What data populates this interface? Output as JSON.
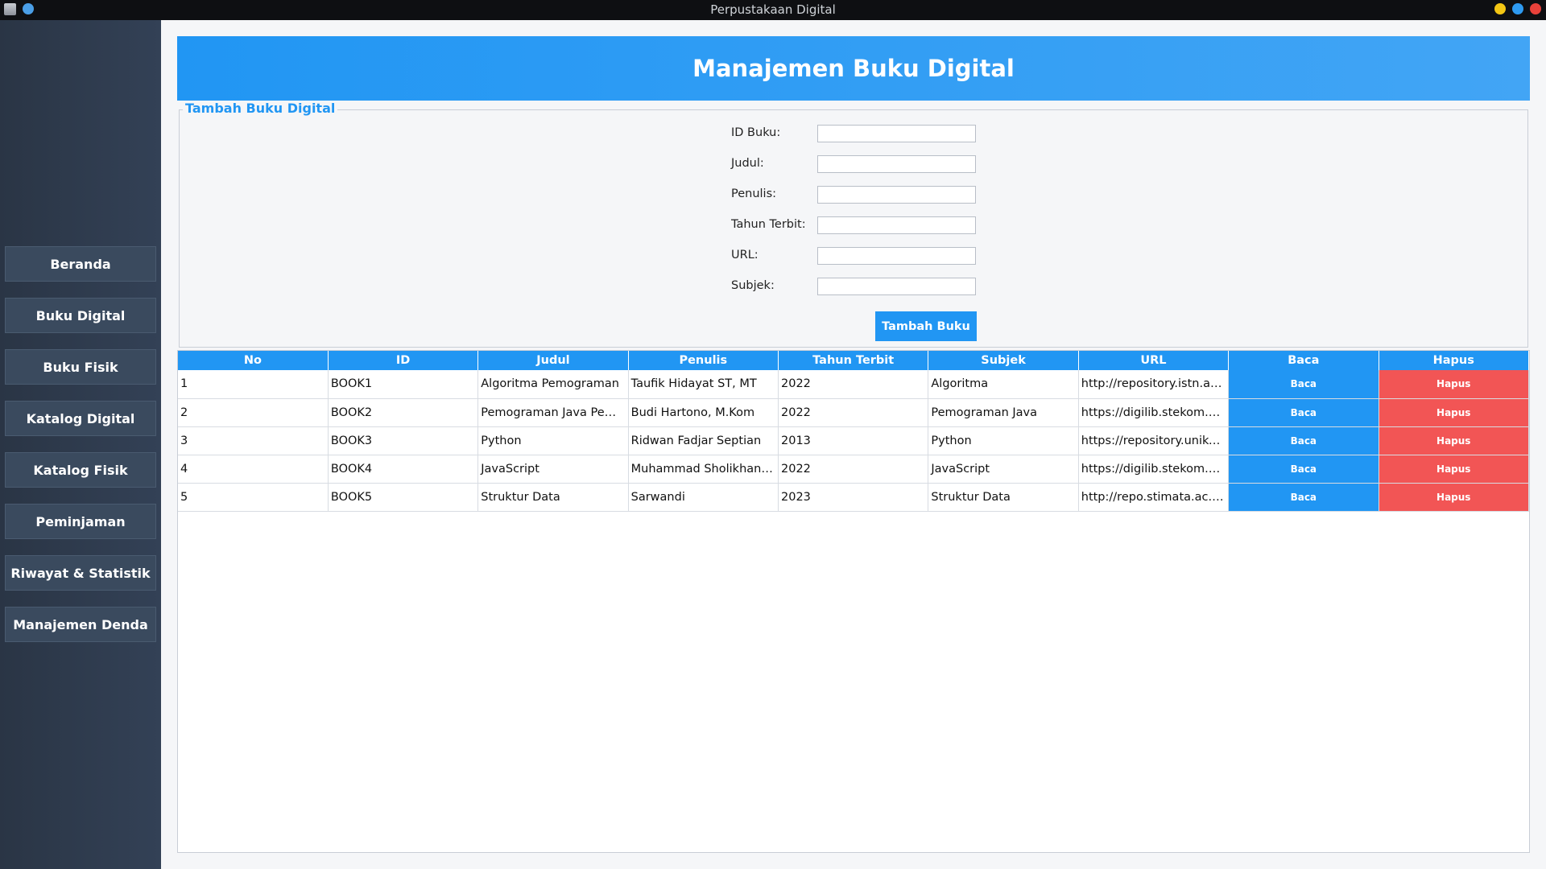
{
  "window": {
    "title": "Perpustakaan Digital"
  },
  "sidebar": {
    "items": [
      {
        "label": "Beranda"
      },
      {
        "label": "Buku Digital"
      },
      {
        "label": "Buku Fisik"
      },
      {
        "label": "Katalog Digital"
      },
      {
        "label": "Katalog Fisik"
      },
      {
        "label": "Peminjaman"
      },
      {
        "label": "Riwayat & Statistik"
      },
      {
        "label": "Manajemen Denda"
      }
    ]
  },
  "header": {
    "title": "Manajemen Buku Digital"
  },
  "form": {
    "legend": "Tambah Buku Digital",
    "fields": [
      {
        "label": "ID Buku:",
        "value": ""
      },
      {
        "label": "Judul:",
        "value": ""
      },
      {
        "label": "Penulis:",
        "value": ""
      },
      {
        "label": "Tahun Terbit:",
        "value": ""
      },
      {
        "label": "URL:",
        "value": ""
      },
      {
        "label": "Subjek:",
        "value": ""
      }
    ],
    "submit_label": "Tambah Buku"
  },
  "table": {
    "columns": [
      "No",
      "ID",
      "Judul",
      "Penulis",
      "Tahun Terbit",
      "Subjek",
      "URL",
      "Baca",
      "Hapus"
    ],
    "rows": [
      {
        "no": "1",
        "id": "BOOK1",
        "judul": "Algoritma Pemograman",
        "penulis": "Taufik Hidayat ST, MT",
        "tahun": "2022",
        "subjek": "Algoritma",
        "url": "http://repository.istn.ac.i...",
        "baca": "Baca",
        "hapus": "Hapus"
      },
      {
        "no": "2",
        "id": "BOOK2",
        "judul": "Pemograman Java Pemula",
        "penulis": "Budi Hartono, M.Kom",
        "tahun": "2022",
        "subjek": "Pemograman Java",
        "url": "https://digilib.stekom.ac....",
        "baca": "Baca",
        "hapus": "Hapus"
      },
      {
        "no": "3",
        "id": "BOOK3",
        "judul": "Python",
        "penulis": "Ridwan Fadjar Septian",
        "tahun": "2013",
        "subjek": "Python",
        "url": "https://repository.uniko...",
        "baca": "Baca",
        "hapus": "Hapus"
      },
      {
        "no": "4",
        "id": "BOOK4",
        "judul": "JavaScript",
        "penulis": "Muhammad Sholikhan, S...",
        "tahun": "2022",
        "subjek": "JavaScript",
        "url": "https://digilib.stekom.ac....",
        "baca": "Baca",
        "hapus": "Hapus"
      },
      {
        "no": "5",
        "id": "BOOK5",
        "judul": "Struktur Data",
        "penulis": "Sarwandi",
        "tahun": "2023",
        "subjek": "Struktur Data",
        "url": "http://repo.stimata.ac.id/...",
        "baca": "Baca",
        "hapus": "Hapus"
      }
    ]
  },
  "colors": {
    "accent": "#2196f3",
    "danger": "#f25555",
    "sidebar": "#2f3b4e"
  }
}
